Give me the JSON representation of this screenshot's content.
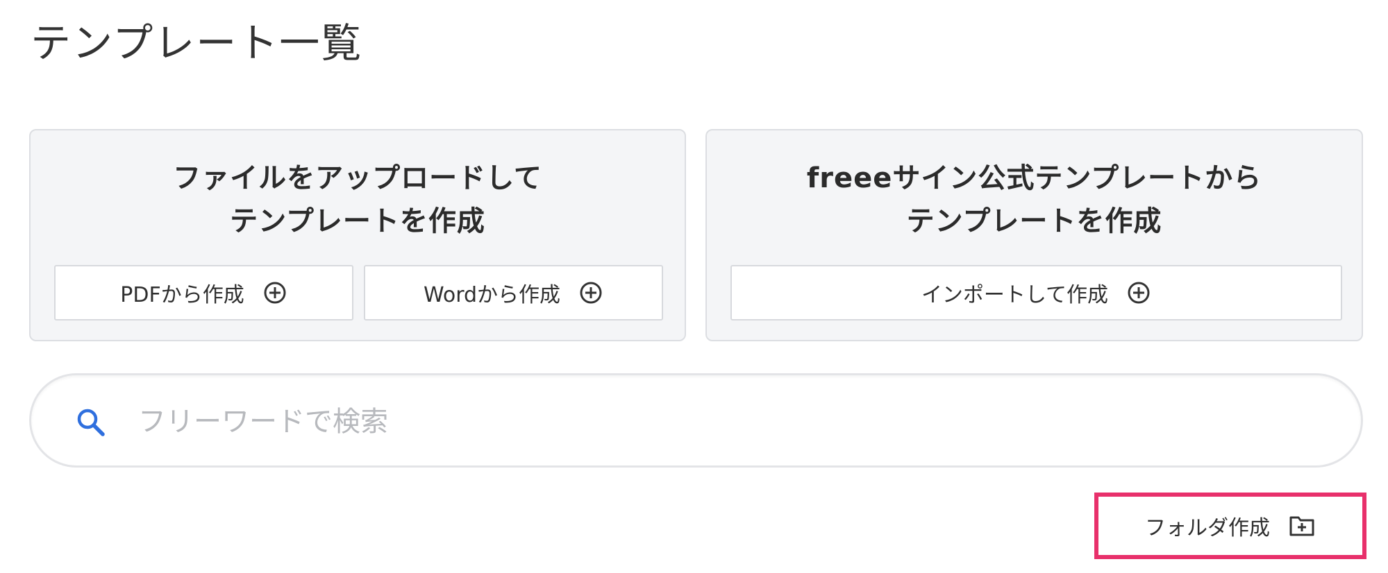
{
  "page": {
    "title": "テンプレート一覧"
  },
  "upload_card": {
    "title_line1": "ファイルをアップロードして",
    "title_line2": "テンプレートを作成",
    "pdf_button": "PDFから作成",
    "word_button": "Wordから作成"
  },
  "official_card": {
    "title_line1": "freeeサイン公式テンプレートから",
    "title_line2": "テンプレートを作成",
    "import_button": "インポートして作成"
  },
  "search": {
    "placeholder": "フリーワードで検索",
    "value": ""
  },
  "folder": {
    "create_label": "フォルダ作成"
  },
  "icons": {
    "search": "search-icon",
    "plus": "plus-circle-icon",
    "folder": "folder-plus-icon"
  },
  "colors": {
    "accent_search": "#2f6fde",
    "highlight": "#e8306b",
    "card_bg": "#f4f5f7"
  }
}
